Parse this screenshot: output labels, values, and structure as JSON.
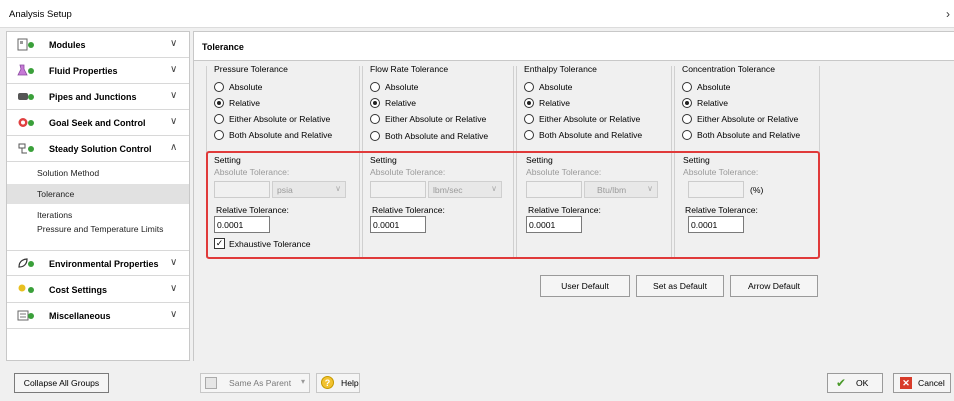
{
  "window": {
    "title": "Analysis Setup",
    "close_glyph": "›"
  },
  "sidebar": {
    "groups": [
      {
        "label": "Modules",
        "icon": "modules-icon",
        "chevron": "∨"
      },
      {
        "label": "Fluid Properties",
        "icon": "fluid-properties-icon",
        "chevron": "∨"
      },
      {
        "label": "Pipes and Junctions",
        "icon": "pipes-junctions-icon",
        "chevron": "∨"
      },
      {
        "label": "Goal Seek and Control",
        "icon": "goal-seek-icon",
        "chevron": "∨"
      },
      {
        "label": "Steady Solution Control",
        "icon": "steady-solution-icon",
        "chevron": "∧"
      },
      {
        "label": "Environmental Properties",
        "icon": "environmental-icon",
        "chevron": "∨"
      },
      {
        "label": "Cost Settings",
        "icon": "cost-settings-icon",
        "chevron": "∨"
      },
      {
        "label": "Miscellaneous",
        "icon": "miscellaneous-icon",
        "chevron": "∨"
      }
    ],
    "subitems": [
      {
        "label": "Solution Method"
      },
      {
        "label": "Tolerance"
      },
      {
        "label": "Iterations"
      },
      {
        "label": "Pressure and Temperature Limits"
      }
    ],
    "selected_subitem": "Tolerance",
    "collapse_label": "Collapse All Groups"
  },
  "main": {
    "header": "Tolerance",
    "options": {
      "absolute": "Absolute",
      "relative": "Relative",
      "either": "Either Absolute or Relative",
      "both": "Both Absolute and Relative"
    },
    "setting_label": "Setting",
    "abs_tol_label": "Absolute Tolerance:",
    "rel_tol_label": "Relative Tolerance:",
    "tolerances": [
      {
        "title": "Pressure Tolerance",
        "selected": "Relative",
        "unit": "psia",
        "abs_value": "",
        "rel_value": "0.0001"
      },
      {
        "title": "Flow Rate Tolerance",
        "selected": "Relative",
        "unit": "lbm/sec",
        "abs_value": "",
        "rel_value": "0.0001"
      },
      {
        "title": "Enthalpy Tolerance",
        "selected": "Relative",
        "unit": "Btu/lbm",
        "abs_value": "",
        "rel_value": "0.0001"
      },
      {
        "title": "Concentration Tolerance",
        "selected": "Relative",
        "unit": "(%)",
        "abs_value": "",
        "rel_value": "0.0001"
      }
    ],
    "exhaustive": {
      "label": "Exhaustive Tolerance",
      "checked": true,
      "check_glyph": "✓"
    },
    "buttons": {
      "user_default": "User Default",
      "set_default": "Set as Default",
      "arrow_default": "Arrow Default"
    }
  },
  "footer": {
    "same_as_parent": "Same As Parent",
    "dropdown_glyph": "▾",
    "help": "Help",
    "help_glyph": "?",
    "ok": "OK",
    "ok_glyph": "✔",
    "cancel": "Cancel",
    "cancel_glyph": "✕"
  },
  "colors": {
    "highlight": "#e03a3a",
    "ok_check": "#4a9a2a",
    "cancel_icon": "#d83b2a"
  }
}
